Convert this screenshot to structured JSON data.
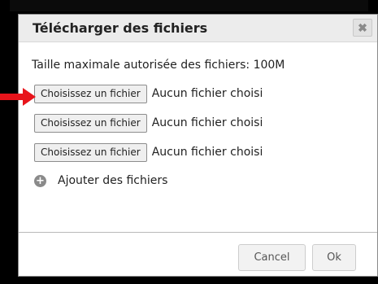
{
  "dialog": {
    "title": "Télécharger des fichiers",
    "close_label": "✖",
    "max_size_text": "Taille maximale autorisée des fichiers: 100M",
    "file_inputs": [
      {
        "button_label": "Choisissez un fichier",
        "status": "Aucun fichier choisi"
      },
      {
        "button_label": "Choisissez un fichier",
        "status": "Aucun fichier choisi"
      },
      {
        "button_label": "Choisissez un fichier",
        "status": "Aucun fichier choisi"
      }
    ],
    "add_files_label": "Ajouter des fichiers",
    "add_icon": "+",
    "cancel_label": "Cancel",
    "ok_label": "Ok"
  },
  "colors": {
    "arrow": "#e8141b",
    "titlebar": "#ececec",
    "backdrop": "#000000"
  }
}
